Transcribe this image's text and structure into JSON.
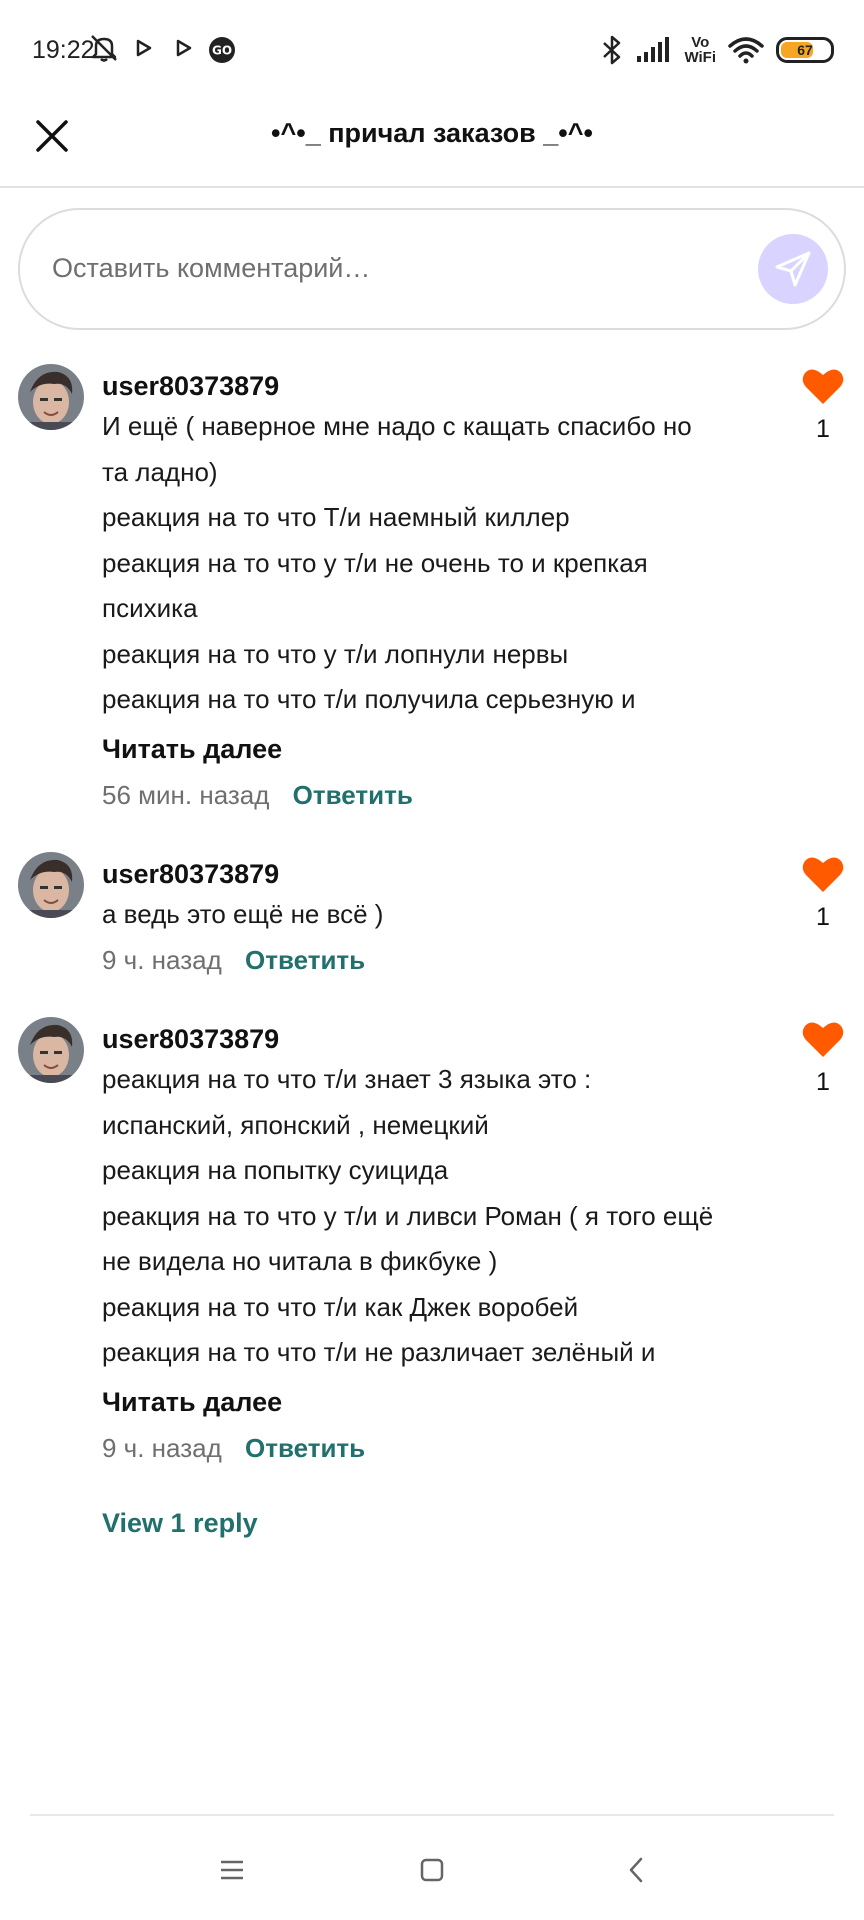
{
  "status_bar": {
    "time": "19:22",
    "vowifi_top": "Vo",
    "vowifi_bottom": "WiFi",
    "battery": "67",
    "battery_level": 0.67,
    "icons": [
      "mute-icon",
      "play-icon",
      "play-icon",
      "go-icon",
      "bluetooth-icon",
      "signal-icon",
      "wifi-icon",
      "battery-icon"
    ]
  },
  "header": {
    "title": "•^•_ причал заказов _•^•"
  },
  "comment_input": {
    "placeholder": "Оставить комментарий…"
  },
  "comments": [
    {
      "username": "user80373879",
      "lines": [
        "И ещё ( наверное мне надо с кащать спасибо но",
        "та ладно)",
        "реакция на то что Т/и наемный киллер",
        "реакция на то что у т/и не очень то и крепкая",
        "психика",
        "реакция на то что  у т/и лопнули нервы",
        "реакция на то что т/и  получила серьезную и"
      ],
      "read_more": "Читать далее",
      "time": "56 мин. назад",
      "reply": "Ответить",
      "likes": "1"
    },
    {
      "username": "user80373879",
      "lines": [
        "а ведь это ещё не всё )"
      ],
      "time": "9 ч. назад",
      "reply": "Ответить",
      "likes": "1"
    },
    {
      "username": "user80373879",
      "lines": [
        "реакция на то что т/и знает 3 языка это :",
        "испанский, японский , немецкий",
        "реакция на попытку суицида",
        "реакция на то что у т/и и ливси Роман ( я того ещё",
        "не видела но читала в фикбуке )",
        "реакция на то что т/и как Джек воробей",
        "реакция на то что т/и не различает зелёный и"
      ],
      "read_more": "Читать далее",
      "time": "9 ч. назад",
      "reply": "Ответить",
      "likes": "1"
    }
  ],
  "view_replies": "View 1 reply",
  "colors": {
    "accent": "#21706e",
    "heart": "#ff5a00",
    "send_bg": "#d9d4ff",
    "battery": "#f7a623"
  }
}
